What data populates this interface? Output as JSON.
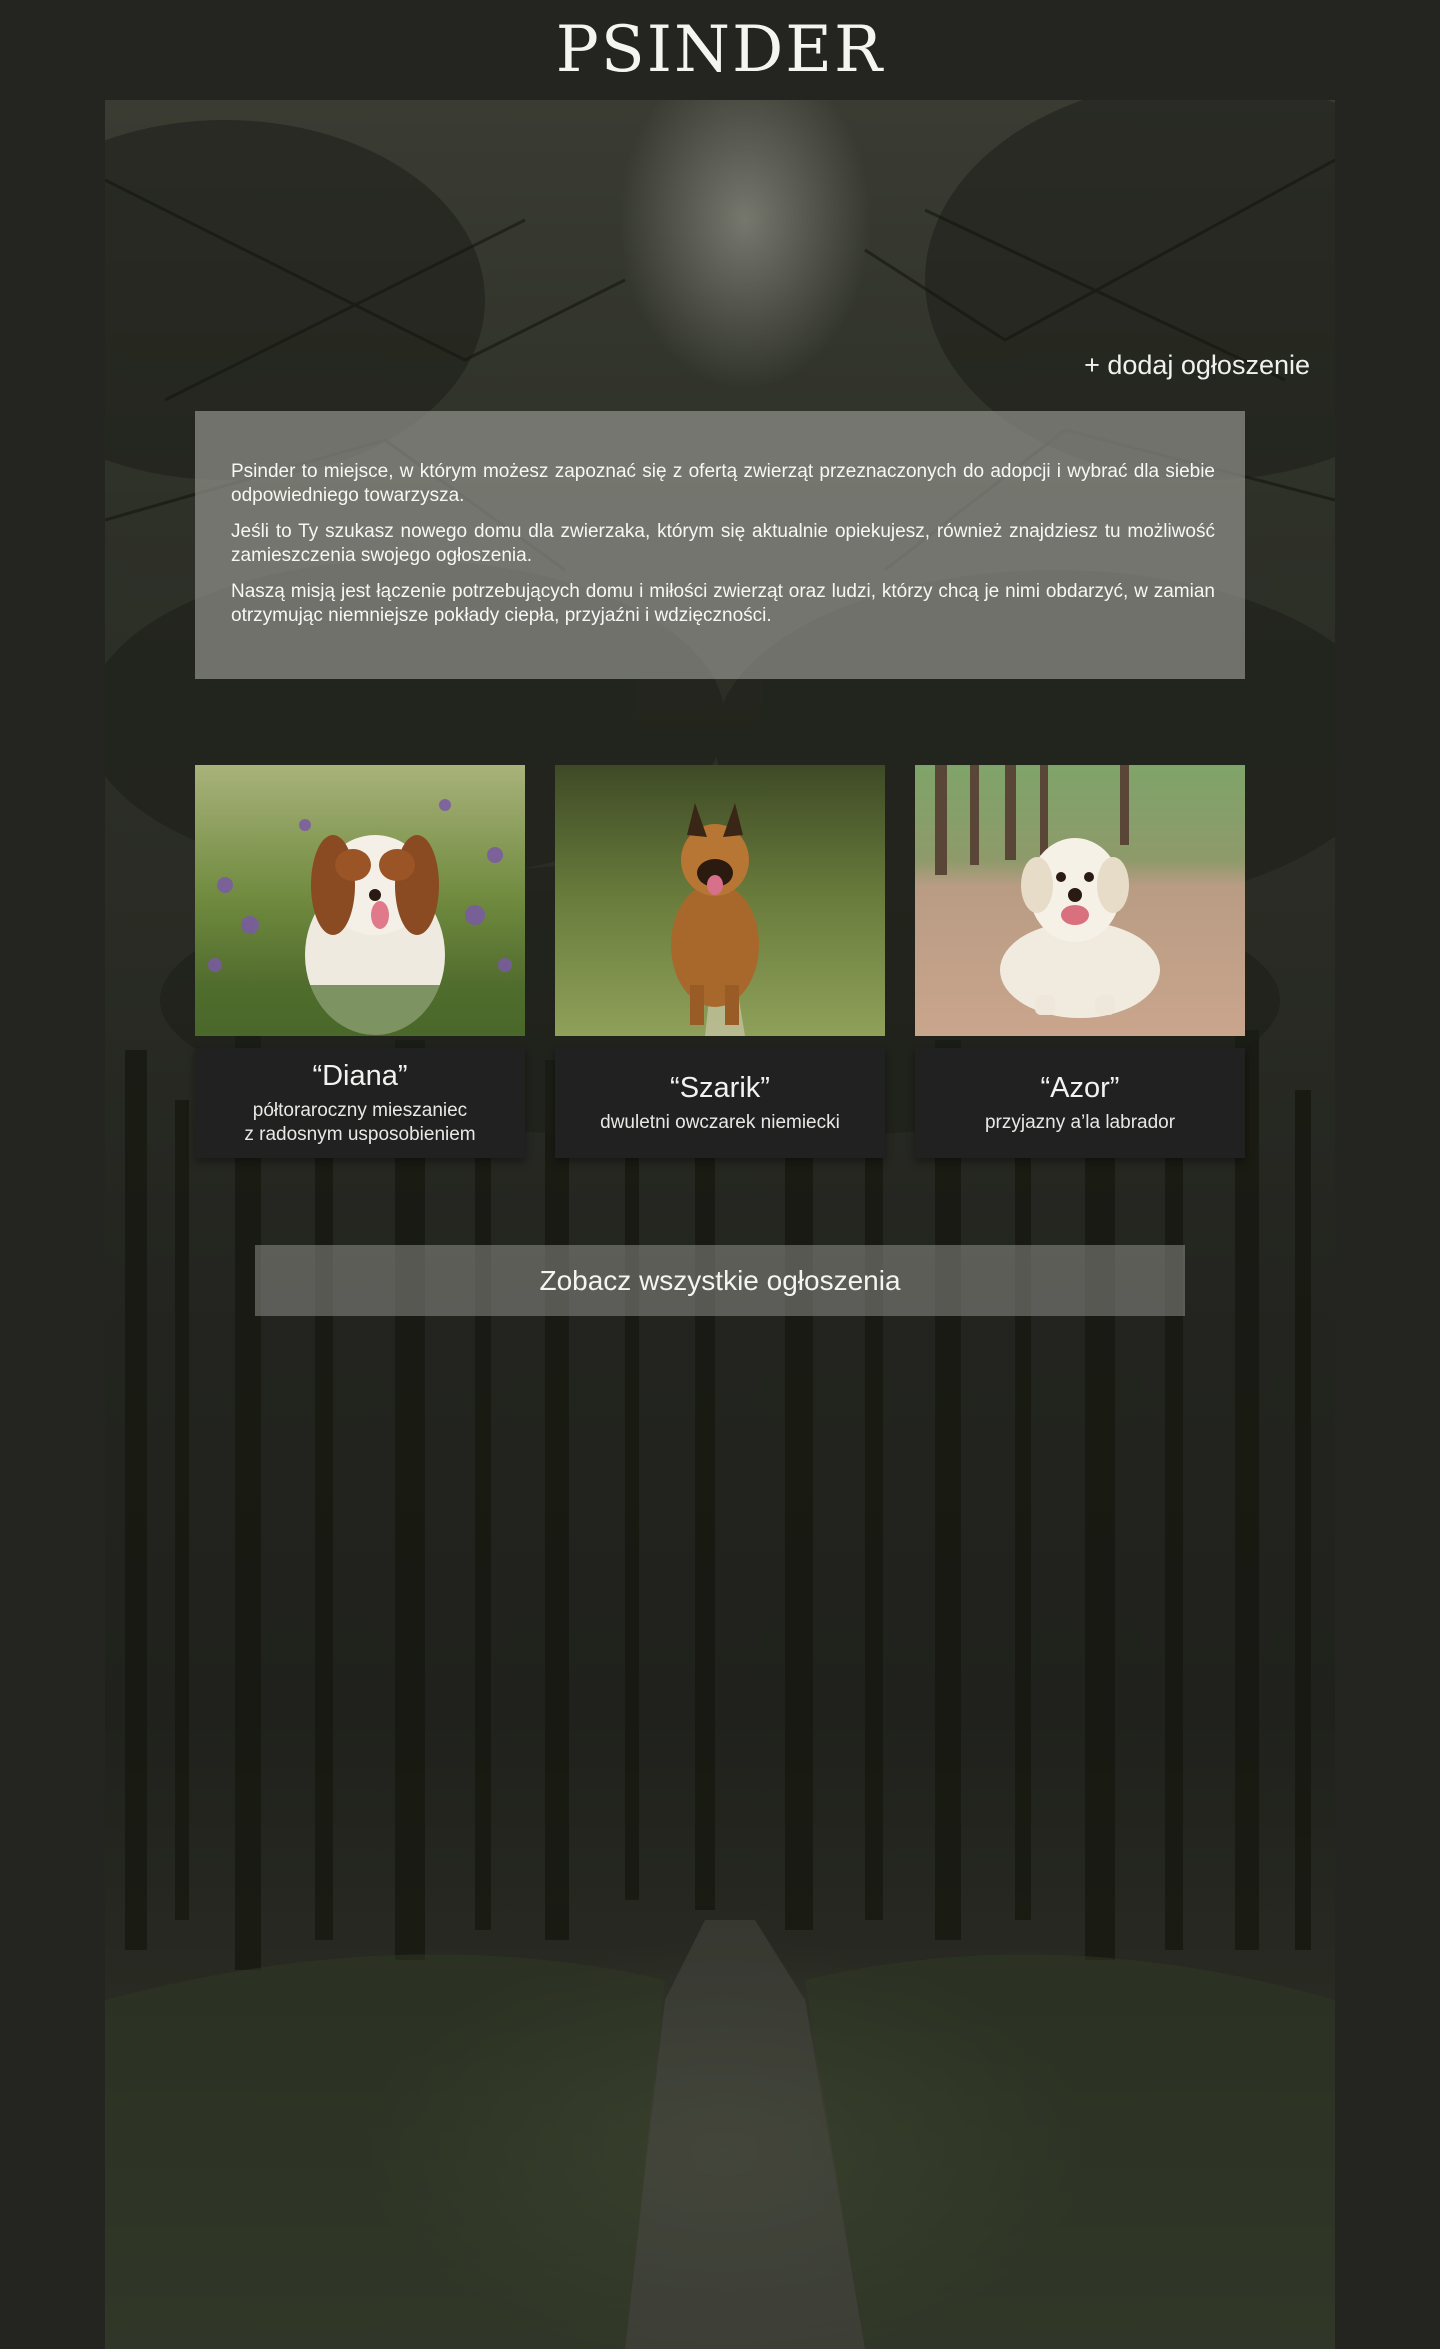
{
  "header": {
    "logo": "PSINDER"
  },
  "actions": {
    "add_listing": "+ dodaj ogłoszenie"
  },
  "intro": {
    "paragraphs": [
      "Psinder to miejsce, w którym możesz zapoznać się z ofertą zwierząt przeznaczonych do adopcji i wybrać dla siebie odpowiedniego towarzysza.",
      "Jeśli to Ty szukasz nowego domu dla zwierzaka, którym się aktualnie opiekujesz, również znajdziesz tu możliwość zamieszczenia swojego ogłoszenia.",
      "Naszą misją jest łączenie potrzebujących domu i miłości zwierząt oraz ludzi, którzy chcą je nimi obdarzyć, w zamian otrzymując niemniejsze pokłady ciepła, przyjaźni i wdzięczności."
    ]
  },
  "dogs": [
    {
      "name": "“Diana”",
      "desc_line1": "półtoraroczny mieszaniec",
      "desc_line2": "z radosnym usposobieniem"
    },
    {
      "name": "“Szarik”",
      "desc_line1": "dwuletni owczarek niemiecki"
    },
    {
      "name": "“Azor”",
      "desc_line1": "przyjazny a’la labrador"
    }
  ],
  "cta": {
    "see_all": "Zobacz wszystkie ogłoszenia"
  },
  "colors": {
    "page_bg": "#242420",
    "card_caption_bg": "#212122",
    "overlay_gray": "#969691"
  }
}
